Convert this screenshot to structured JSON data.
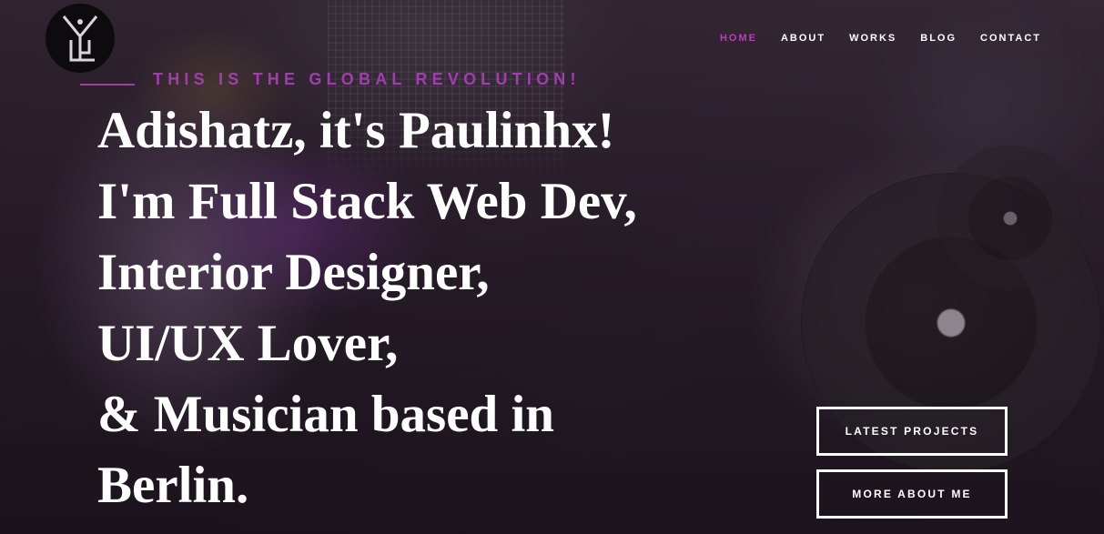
{
  "nav": {
    "items": [
      {
        "label": "HOME",
        "active": true
      },
      {
        "label": "ABOUT",
        "active": false
      },
      {
        "label": "WORKS",
        "active": false
      },
      {
        "label": "BLOG",
        "active": false
      },
      {
        "label": "CONTACT",
        "active": false
      }
    ]
  },
  "logo": {
    "icon": "monogram-logo-icon"
  },
  "hero": {
    "tagline": "THIS IS THE GLOBAL REVOLUTION!",
    "headline_lines": [
      "Adishatz, it's Paulinhx!",
      "I'm Full Stack Web Dev,",
      "Interior Designer,",
      "UI/UX Lover,",
      "& Musician based in",
      "Berlin."
    ],
    "buttons": {
      "latest_projects": "LATEST PROJECTS",
      "more_about_me": "MORE ABOUT ME"
    }
  },
  "colors": {
    "accent": "#b73fb8",
    "tagline": "#a33cb0",
    "text": "#ffffff"
  }
}
